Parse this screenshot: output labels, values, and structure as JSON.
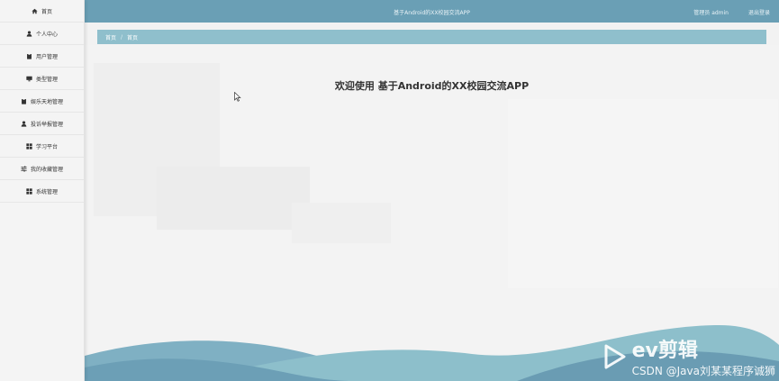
{
  "header": {
    "title": "基于Android的XX校园交流APP",
    "user": "管理员 admin",
    "logout": "退出登录"
  },
  "sidebar": {
    "items": [
      {
        "label": "首页",
        "icon": "home-icon"
      },
      {
        "label": "个人中心",
        "icon": "user-icon"
      },
      {
        "label": "用户管理",
        "icon": "clipboard-icon"
      },
      {
        "label": "类型管理",
        "icon": "monitor-icon"
      },
      {
        "label": "娱乐天地管理",
        "icon": "clipboard-icon"
      },
      {
        "label": "投诉举报管理",
        "icon": "user-icon"
      },
      {
        "label": "学习平台",
        "icon": "grid-icon"
      },
      {
        "label": "我的收藏管理",
        "icon": "sliders-icon"
      },
      {
        "label": "系统管理",
        "icon": "grid-icon"
      }
    ]
  },
  "breadcrumb": {
    "home": "首页",
    "separator": "/",
    "current": "首页"
  },
  "main": {
    "welcome": "欢迎使用 基于Android的XX校园交流APP"
  },
  "watermark": {
    "brand": "ev剪辑",
    "text": "CSDN @Java刘某某程序诚狮"
  },
  "colors": {
    "topbar": "#6a9fb5",
    "breadcrumb": "#8fbfcc",
    "wave_dark": "#6c9fb6",
    "wave_light": "#8dbfcb"
  }
}
